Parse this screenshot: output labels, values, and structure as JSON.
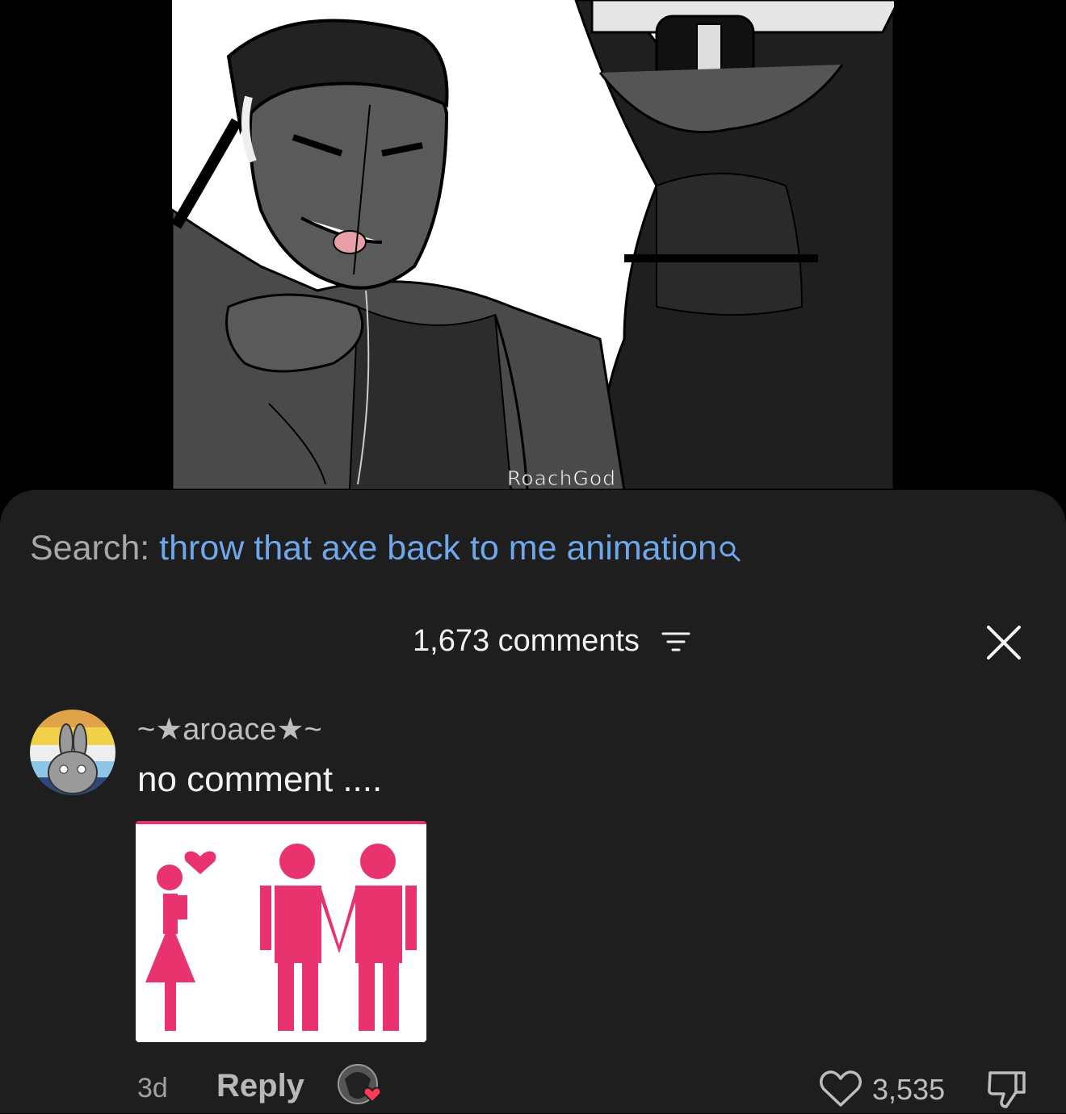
{
  "video": {
    "watermark": "RoachGod"
  },
  "search": {
    "prefix": "Search:",
    "query": "throw that axe back to me animation",
    "icon": "search-icon"
  },
  "comments_header": {
    "count_label": "1,673 comments",
    "sort_icon": "sort-lines-icon",
    "close_icon": "close-icon"
  },
  "comment": {
    "username": "~★aroace★~",
    "text": "no comment ....",
    "sticker": "pink-couple-sticker",
    "time": "3d",
    "reply_label": "Reply",
    "likes": "3,535",
    "colors": {
      "like_heart": "#ff3b5c",
      "sticker_pink": "#e8336f"
    }
  },
  "colors": {
    "sheet_bg": "#1e1e1e",
    "search_query": "#6ea8ea",
    "muted_text": "#a8a8a8"
  }
}
